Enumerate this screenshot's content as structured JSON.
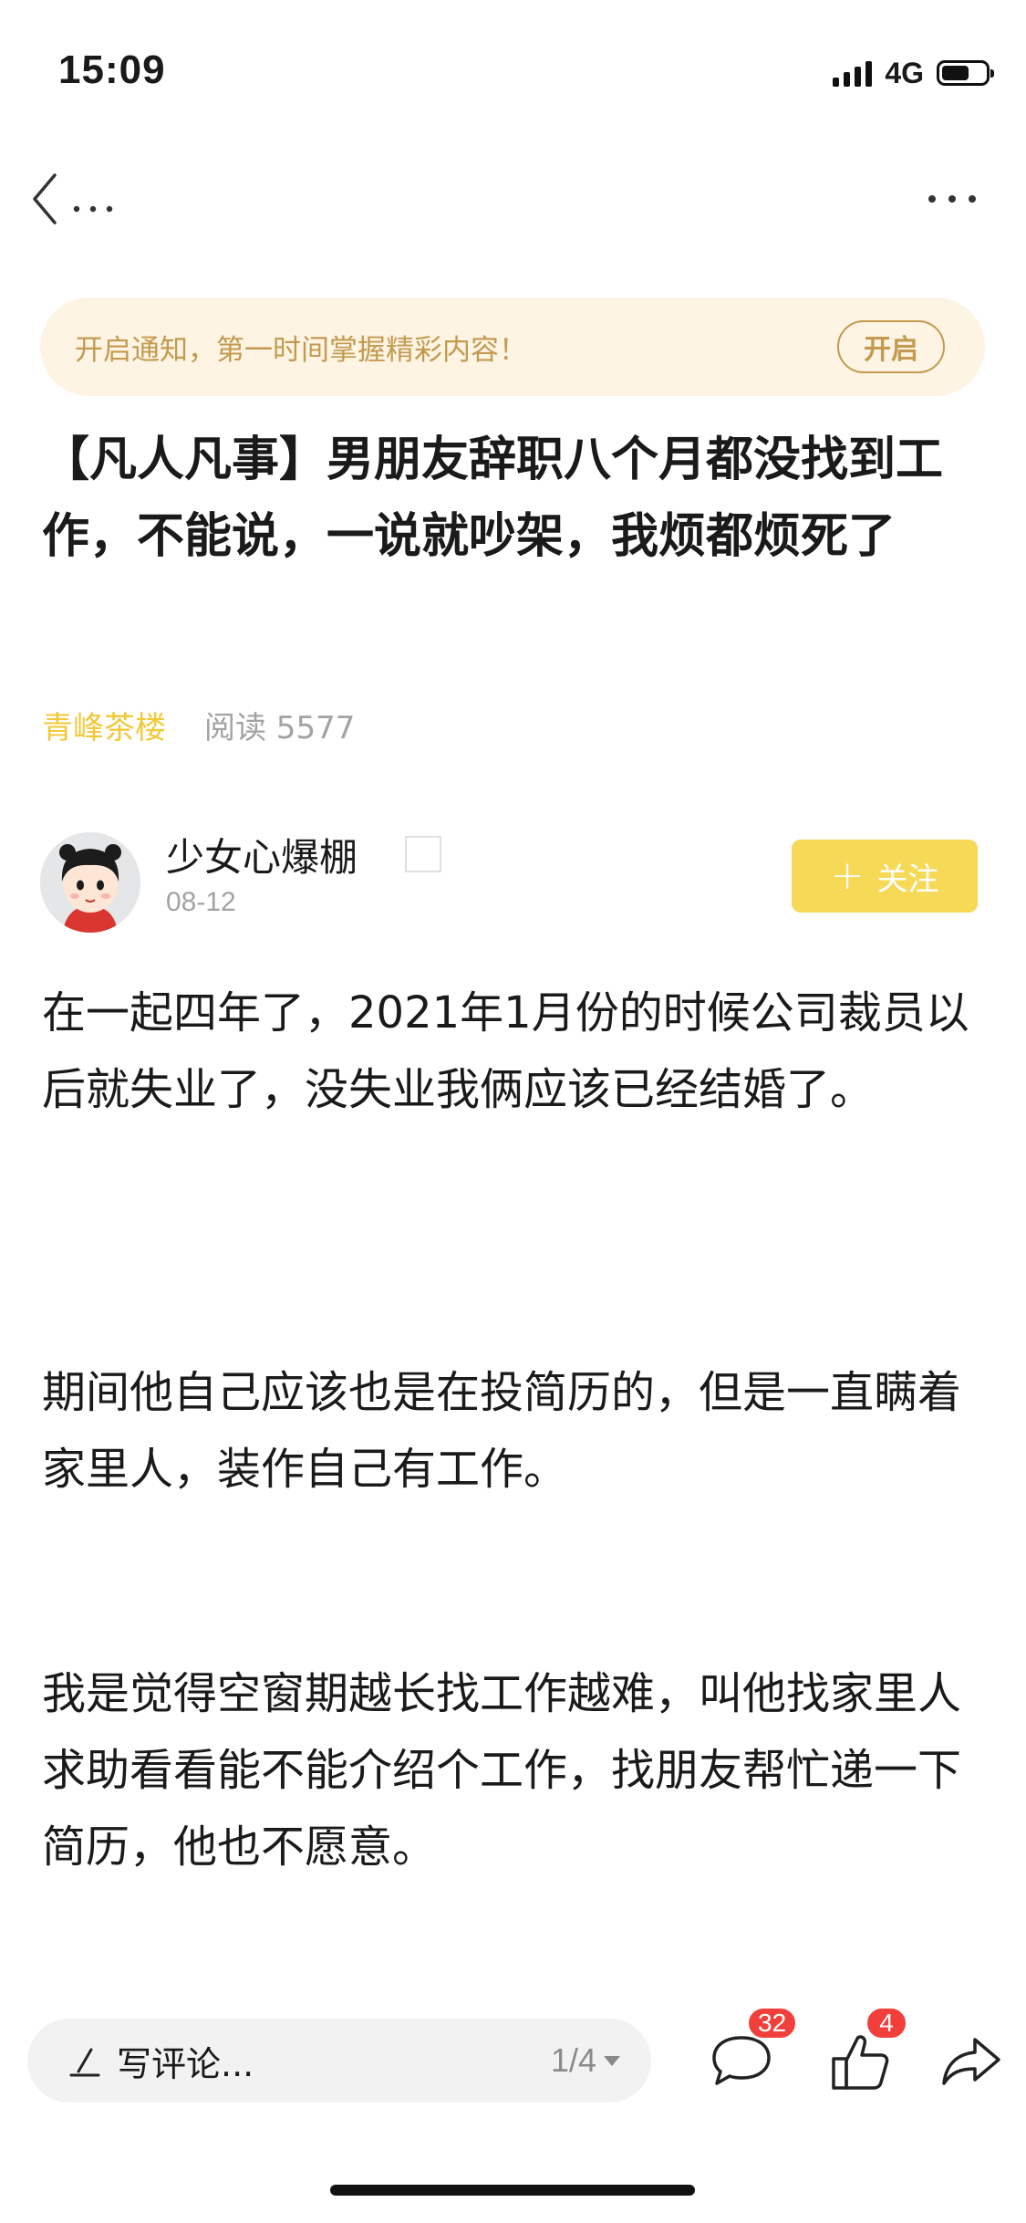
{
  "status_bar": {
    "time": "15:09",
    "network": "4G",
    "battery_level": 0.62
  },
  "nav": {
    "back_icon": "chevron-left-icon",
    "back_ellipsis": "…",
    "more_icon": "more-horizontal-icon"
  },
  "notification": {
    "text": "开启通知，第一时间掌握精彩内容！",
    "button_label": "开启"
  },
  "article": {
    "title": "【凡人凡事】男朋友辞职八个月都没找到工作，不能说，一说就吵架，我烦都烦死了",
    "source": "青峰茶楼",
    "reads_label": "阅读 5577",
    "author": {
      "name": "少女心爆棚",
      "date": "08-12",
      "avatar_icon": "cartoon-girl-avatar"
    },
    "follow_label": "关注",
    "paragraphs": [
      "在一起四年了，2021年1月份的时候公司裁员以后就失业了，没失业我俩应该已经结婚了。",
      "期间他自己应该也是在投简历的，但是一直瞒着家里人，装作自己有工作。",
      "我是觉得空窗期越长找工作越难，叫他找家里人求助看看能不能介绍个工作，找朋友帮忙递一下简历，他也不愿意。"
    ]
  },
  "bottom_bar": {
    "comment_placeholder": "写评论...",
    "page_indicator": "1/4",
    "comment_count": "32",
    "like_count": "4",
    "icons": [
      "pencil-icon",
      "comment-icon",
      "thumbs-up-icon",
      "share-icon"
    ]
  },
  "colors": {
    "accent_yellow": "#f6d957",
    "source_yellow": "#f1c93a",
    "notify_bg": "#fdf4e3",
    "notify_text": "#c39a4f",
    "badge_red": "#f1403c"
  }
}
